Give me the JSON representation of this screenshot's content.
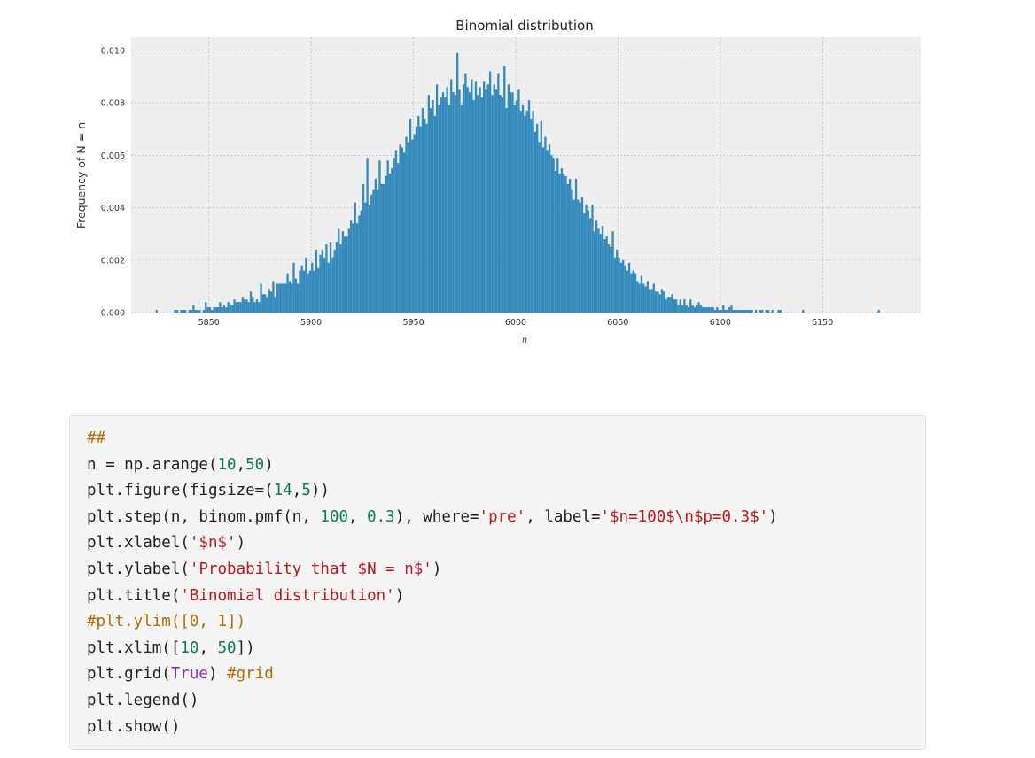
{
  "chart_data": {
    "type": "bar",
    "title": "Binomial distribution",
    "xlabel": "n",
    "ylabel": "Frequency of N = n",
    "xlim": [
      5812,
      6198
    ],
    "ylim": [
      0,
      0.0105
    ],
    "xticks": [
      "5850",
      "5900",
      "5950",
      "6000",
      "6050",
      "6100",
      "6150"
    ],
    "xtick_values": [
      5850,
      5900,
      5950,
      6000,
      6050,
      6100,
      6150
    ],
    "yticks": [
      "0.000",
      "0.002",
      "0.004",
      "0.006",
      "0.008",
      "0.010"
    ],
    "ytick_values": [
      0,
      0.002,
      0.004,
      0.006,
      0.008,
      0.01
    ],
    "grid": true,
    "bar_color": "#348abd",
    "background_color": "#eeeeee",
    "series": [
      {
        "x_start": 5824,
        "bin_width": 1,
        "values": [
          0.0001,
          0,
          0,
          0,
          0,
          0,
          0,
          0,
          0,
          0.0001,
          0.0001,
          0,
          0.0001,
          0.0001,
          0.0001,
          0,
          0.0001,
          0.0001,
          0.0003,
          0.0001,
          0.0001,
          0.0001,
          0,
          0.0001,
          0.0004,
          0.0002,
          0.0002,
          0.0001,
          0.0002,
          0.0002,
          0.0002,
          0.0004,
          0.0002,
          0.0003,
          0.0002,
          0.0004,
          0.0003,
          0.0003,
          0.0005,
          0.0004,
          0.0004,
          0.0004,
          0.0006,
          0.0005,
          0.0005,
          0.0004,
          0.0008,
          0.0006,
          0.0004,
          0.0005,
          0.0004,
          0.0011,
          0.0007,
          0.0007,
          0.0006,
          0.0009,
          0.0008,
          0.0012,
          0.0006,
          0.0011,
          0.0011,
          0.0011,
          0.0011,
          0.0011,
          0.0015,
          0.0012,
          0.0011,
          0.0019,
          0.0013,
          0.0011,
          0.0016,
          0.0018,
          0.0016,
          0.0021,
          0.0015,
          0.0016,
          0.0019,
          0.0016,
          0.0024,
          0.0017,
          0.0022,
          0.0024,
          0.0021,
          0.0026,
          0.0019,
          0.0027,
          0.0021,
          0.0024,
          0.0027,
          0.0032,
          0.0026,
          0.0031,
          0.0029,
          0.0029,
          0.0032,
          0.0035,
          0.0034,
          0.0042,
          0.0034,
          0.0037,
          0.0039,
          0.0049,
          0.0042,
          0.0059,
          0.0041,
          0.0045,
          0.0047,
          0.0051,
          0.0047,
          0.0058,
          0.0049,
          0.0049,
          0.0052,
          0.0058,
          0.0053,
          0.0055,
          0.0059,
          0.0062,
          0.0057,
          0.0064,
          0.0063,
          0.0061,
          0.0067,
          0.0065,
          0.0074,
          0.0066,
          0.0068,
          0.0071,
          0.0075,
          0.0071,
          0.0078,
          0.0074,
          0.0072,
          0.0083,
          0.0078,
          0.0081,
          0.0075,
          0.0087,
          0.0079,
          0.0082,
          0.0084,
          0.0082,
          0.0086,
          0.0079,
          0.0089,
          0.0084,
          0.0083,
          0.0099,
          0.0085,
          0.0079,
          0.0087,
          0.0091,
          0.0086,
          0.0084,
          0.0089,
          0.0081,
          0.0088,
          0.0083,
          0.0086,
          0.0082,
          0.0088,
          0.0085,
          0.0087,
          0.0092,
          0.0083,
          0.0087,
          0.0085,
          0.0091,
          0.0083,
          0.0082,
          0.0094,
          0.0078,
          0.0087,
          0.0084,
          0.0084,
          0.0079,
          0.0081,
          0.0085,
          0.0077,
          0.0079,
          0.0075,
          0.0077,
          0.0081,
          0.0074,
          0.0077,
          0.0069,
          0.0072,
          0.0065,
          0.0073,
          0.0063,
          0.0067,
          0.0062,
          0.0064,
          0.006,
          0.0059,
          0.0054,
          0.0059,
          0.0053,
          0.0055,
          0.0053,
          0.0052,
          0.0049,
          0.0051,
          0.0047,
          0.0043,
          0.0051,
          0.0043,
          0.0042,
          0.0044,
          0.0038,
          0.0041,
          0.0039,
          0.0036,
          0.0041,
          0.0031,
          0.0035,
          0.0032,
          0.003,
          0.0033,
          0.0028,
          0.0029,
          0.0026,
          0.0025,
          0.0031,
          0.0021,
          0.0024,
          0.0021,
          0.0019,
          0.002,
          0.0018,
          0.0016,
          0.0019,
          0.0015,
          0.0016,
          0.0015,
          0.0012,
          0.0011,
          0.0014,
          0.0011,
          0.001,
          0.0012,
          0.0009,
          0.0009,
          0.0011,
          0.0008,
          0.0008,
          0.0007,
          0.0009,
          0.0008,
          0.0005,
          0.0006,
          0.0006,
          0.0007,
          0.0005,
          0.0005,
          0.0003,
          0.0005,
          0.0003,
          0.0005,
          0.0003,
          0.0002,
          0.0005,
          0.0003,
          0.0002,
          0.0003,
          0.0004,
          0.0003,
          0.0002,
          0.0002,
          0.0002,
          0.0002,
          0.0002,
          0.0002,
          0.0001,
          0.0002,
          0.0001,
          0.0001,
          0.0003,
          0.0001,
          0.0001,
          0.0002,
          0.0003,
          0.0001,
          0.0001,
          0.0001,
          0.0001,
          0.0001,
          0.0001,
          0.0001,
          0.0001,
          0.0001,
          0.0001,
          0,
          0.0001,
          0,
          0.0001,
          0.0001,
          0,
          0.0001,
          0.0001,
          0,
          0.0001,
          0,
          0,
          0.0001,
          0.0001,
          0,
          0,
          0,
          0,
          0,
          0,
          0,
          0,
          0,
          0,
          0.0001,
          0,
          0,
          0,
          0,
          0,
          0,
          0,
          0,
          0,
          0,
          0,
          0,
          0,
          0,
          0,
          0,
          0,
          0,
          0,
          0,
          0,
          0,
          0,
          0,
          0,
          0,
          0,
          0,
          0,
          0,
          0,
          0,
          0,
          0,
          0,
          0,
          0.0001
        ]
      }
    ]
  },
  "code": {
    "lines": [
      [
        {
          "t": "##",
          "c": "comment"
        }
      ],
      [
        {
          "t": "n = np.arange(",
          "c": "plain"
        },
        {
          "t": "10",
          "c": "num"
        },
        {
          "t": ",",
          "c": "plain"
        },
        {
          "t": "50",
          "c": "num"
        },
        {
          "t": ")",
          "c": "plain"
        }
      ],
      [
        {
          "t": "plt.figure(figsize=(",
          "c": "plain"
        },
        {
          "t": "14",
          "c": "num"
        },
        {
          "t": ",",
          "c": "plain"
        },
        {
          "t": "5",
          "c": "num"
        },
        {
          "t": "))",
          "c": "plain"
        }
      ],
      [
        {
          "t": "plt.step(n, binom.pmf(n, ",
          "c": "plain"
        },
        {
          "t": "100",
          "c": "num"
        },
        {
          "t": ", ",
          "c": "plain"
        },
        {
          "t": "0.3",
          "c": "num"
        },
        {
          "t": "), where=",
          "c": "plain"
        },
        {
          "t": "'pre'",
          "c": "str"
        },
        {
          "t": ", label=",
          "c": "plain"
        },
        {
          "t": "'$n=100$\\n$p=0.3$'",
          "c": "str"
        },
        {
          "t": ")",
          "c": "plain"
        }
      ],
      [
        {
          "t": "plt.xlabel(",
          "c": "plain"
        },
        {
          "t": "'$n$'",
          "c": "str"
        },
        {
          "t": ")",
          "c": "plain"
        }
      ],
      [
        {
          "t": "plt.ylabel(",
          "c": "plain"
        },
        {
          "t": "'Probability that $N = n$'",
          "c": "str"
        },
        {
          "t": ")",
          "c": "plain"
        }
      ],
      [
        {
          "t": "plt.title(",
          "c": "plain"
        },
        {
          "t": "'Binomial distribution'",
          "c": "str"
        },
        {
          "t": ")",
          "c": "plain"
        }
      ],
      [
        {
          "t": "#plt.ylim([0, 1])",
          "c": "comment"
        }
      ],
      [
        {
          "t": "plt.xlim([",
          "c": "plain"
        },
        {
          "t": "10",
          "c": "num"
        },
        {
          "t": ", ",
          "c": "plain"
        },
        {
          "t": "50",
          "c": "num"
        },
        {
          "t": "])",
          "c": "plain"
        }
      ],
      [
        {
          "t": "plt.grid(",
          "c": "plain"
        },
        {
          "t": "True",
          "c": "kw"
        },
        {
          "t": ") ",
          "c": "plain"
        },
        {
          "t": "#grid",
          "c": "comment"
        }
      ],
      [
        {
          "t": "plt.legend()",
          "c": "plain"
        }
      ],
      [
        {
          "t": "plt.show()",
          "c": "plain"
        }
      ]
    ]
  }
}
